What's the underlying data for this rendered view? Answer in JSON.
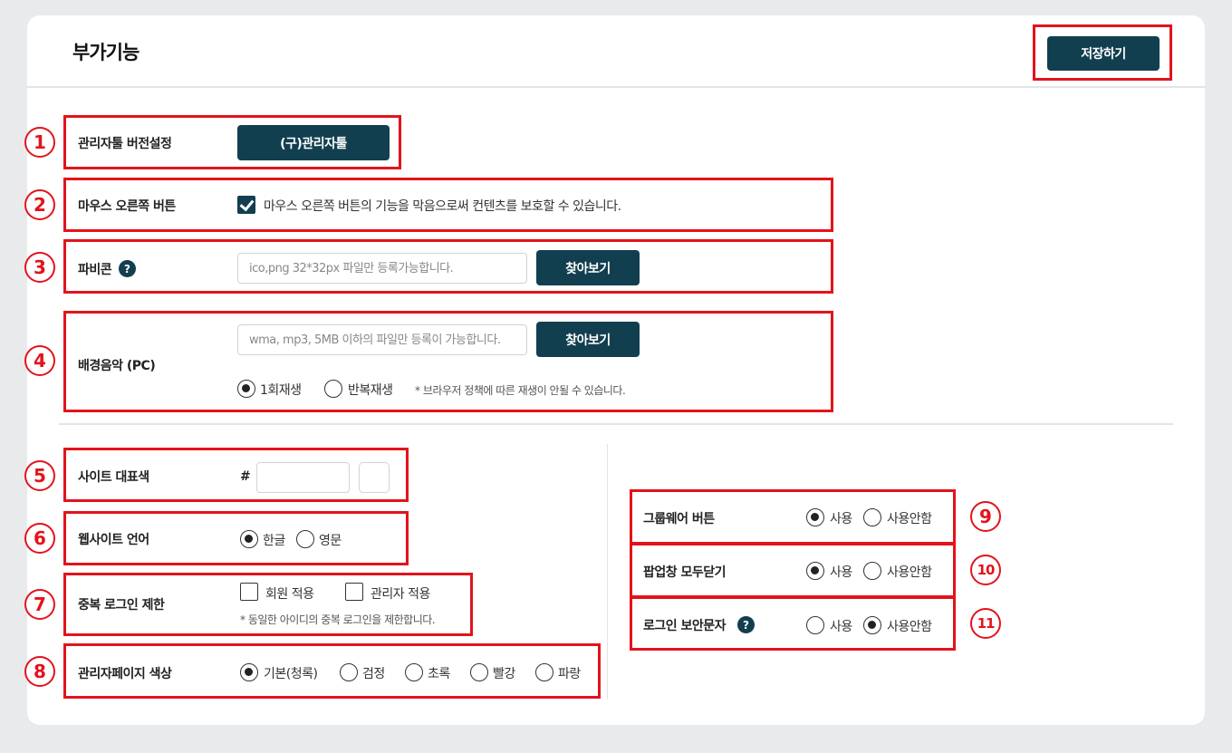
{
  "header": {
    "title": "부가기능",
    "save_label": "저장하기"
  },
  "colors": {
    "primary": "#123f4f",
    "annotation": "#e3131b"
  },
  "markers": [
    "1",
    "2",
    "3",
    "4",
    "5",
    "6",
    "7",
    "8",
    "9",
    "10",
    "11"
  ],
  "admin_tool": {
    "label": "관리자툴 버전설정",
    "button": "(구)관리자툴"
  },
  "right_click": {
    "label": "마우스 오른쪽 버튼",
    "checked": true,
    "text": "마우스 오른쪽 버튼의 기능을 막음으로써 컨텐츠를 보호할 수 있습니다."
  },
  "favicon": {
    "label": "파비콘",
    "help": "?",
    "placeholder": "ico,png 32*32px 파일만 등록가능합니다.",
    "button": "찾아보기"
  },
  "bgm": {
    "label": "배경음악 (PC)",
    "placeholder": "wma, mp3, 5MB 이하의 파일만 등록이 가능합니다.",
    "button": "찾아보기",
    "options": [
      {
        "label": "1회재생",
        "selected": true
      },
      {
        "label": "반복재생",
        "selected": false
      }
    ],
    "note": "* 브라우저 정책에 따른 재생이 안될 수 있습니다."
  },
  "site_color": {
    "label": "사이트 대표색",
    "hash": "#",
    "value": ""
  },
  "language": {
    "label": "웹사이트 언어",
    "options": [
      {
        "label": "한글",
        "selected": true
      },
      {
        "label": "영문",
        "selected": false
      }
    ]
  },
  "dup_login": {
    "label": "중복 로그인 제한",
    "options": [
      {
        "label": "회원 적용",
        "checked": false
      },
      {
        "label": "관리자 적용",
        "checked": false
      }
    ],
    "note": "* 동일한 아이디의 중복 로그인을 제한합니다."
  },
  "admin_color": {
    "label": "관리자페이지 색상",
    "options": [
      {
        "label": "기본(청록)",
        "selected": true
      },
      {
        "label": "검정",
        "selected": false
      },
      {
        "label": "초록",
        "selected": false
      },
      {
        "label": "빨강",
        "selected": false
      },
      {
        "label": "파랑",
        "selected": false
      }
    ]
  },
  "groupware": {
    "label": "그룹웨어 버튼",
    "options": [
      {
        "label": "사용",
        "selected": true
      },
      {
        "label": "사용안함",
        "selected": false
      }
    ]
  },
  "popup_close": {
    "label": "팝업창 모두닫기",
    "options": [
      {
        "label": "사용",
        "selected": true
      },
      {
        "label": "사용안함",
        "selected": false
      }
    ]
  },
  "login_sms": {
    "label": "로그인 보안문자",
    "help": "?",
    "options": [
      {
        "label": "사용",
        "selected": false
      },
      {
        "label": "사용안함",
        "selected": true
      }
    ]
  }
}
